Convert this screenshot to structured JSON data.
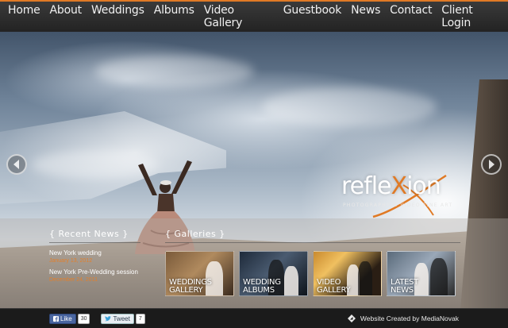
{
  "nav": {
    "items": [
      "Home",
      "About",
      "Weddings",
      "Albums",
      "Video Gallery",
      "Guestbook",
      "News",
      "Contact",
      "Client Login"
    ]
  },
  "hero": {
    "logo_word_a": "refle",
    "logo_word_x": "X",
    "logo_word_b": "ion",
    "logo_tagline": "PHOTOGRAPHY & VIDEO FINE ART"
  },
  "news": {
    "title": "{ Recent News }",
    "items": [
      {
        "title": "New York wedding",
        "date": "January 13, 2012"
      },
      {
        "title": "New York Pre-Wedding session",
        "date": "December 24, 2011"
      }
    ]
  },
  "galleries": {
    "title": "{ Galleries }",
    "items": [
      {
        "line1": "WEDDINGS",
        "line2": "GALLERY"
      },
      {
        "line1": "WEDDING",
        "line2": "ALBUMS"
      },
      {
        "line1": "VIDEO",
        "line2": "GALLERY"
      },
      {
        "line1": "LATEST",
        "line2": "NEWS"
      }
    ]
  },
  "footer": {
    "like_label": "Like",
    "like_count": "30",
    "tweet_label": "Tweet",
    "tweet_count": "7",
    "credit": "Website Created by MediaNovak"
  },
  "colors": {
    "accent": "#e07a25",
    "nav_bg": "#2a2a2a",
    "footer_bg": "#1b1b1b"
  }
}
